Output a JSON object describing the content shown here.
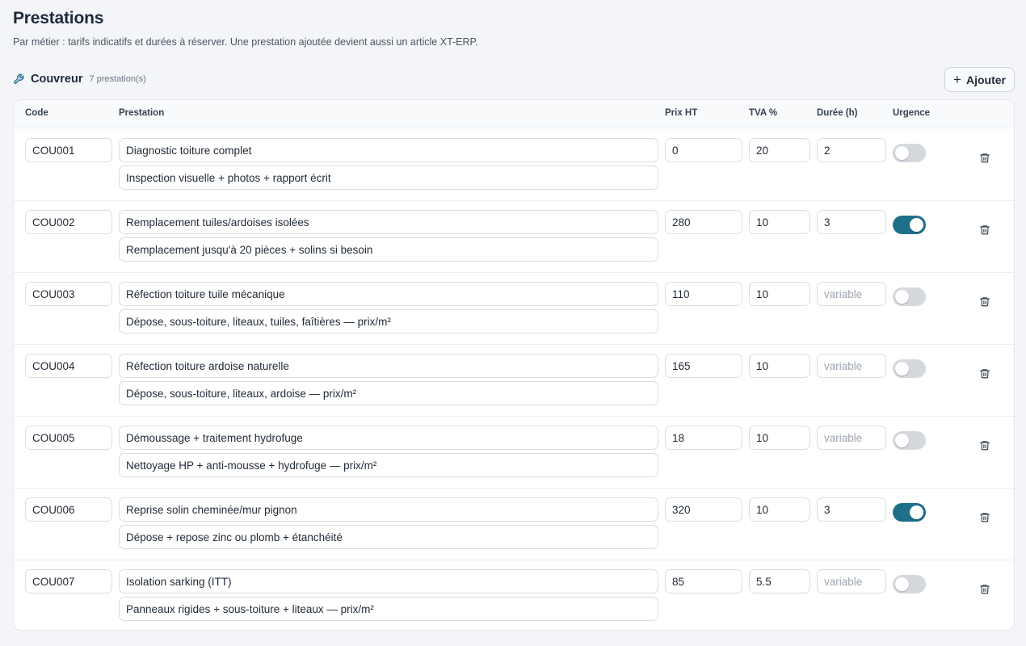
{
  "page": {
    "title": "Prestations",
    "subtitle": "Par métier : tarifs indicatifs et durées à réserver. Une prestation ajoutée devient aussi un article XT-ERP."
  },
  "section": {
    "icon": "wrench-icon",
    "title": "Couvreur",
    "count": "7 prestation(s)",
    "add_label": "Ajouter",
    "add_icon": "plus-icon"
  },
  "table": {
    "headers": {
      "code": "Code",
      "prestation": "Prestation",
      "prix": "Prix HT",
      "tva": "TVA %",
      "duree": "Durée (h)",
      "urgence": "Urgence"
    },
    "duration_placeholder": "variable",
    "accent_color": "#1f6f8b",
    "rows": [
      {
        "code": "COU001",
        "name": "Diagnostic toiture complet",
        "description": "Inspection visuelle + photos + rapport écrit",
        "prix": "0",
        "tva": "20",
        "duree": "2",
        "urgence": false
      },
      {
        "code": "COU002",
        "name": "Remplacement tuiles/ardoises isolées",
        "description": "Remplacement jusqu'à 20 pièces + solins si besoin",
        "prix": "280",
        "tva": "10",
        "duree": "3",
        "urgence": true
      },
      {
        "code": "COU003",
        "name": "Réfection toiture tuile mécanique",
        "description": "Dépose, sous-toiture, liteaux, tuiles, faîtières — prix/m²",
        "prix": "110",
        "tva": "10",
        "duree": "",
        "urgence": false
      },
      {
        "code": "COU004",
        "name": "Réfection toiture ardoise naturelle",
        "description": "Dépose, sous-toiture, liteaux, ardoise — prix/m²",
        "prix": "165",
        "tva": "10",
        "duree": "",
        "urgence": false
      },
      {
        "code": "COU005",
        "name": "Démoussage + traitement hydrofuge",
        "description": "Nettoyage HP + anti-mousse + hydrofuge — prix/m²",
        "prix": "18",
        "tva": "10",
        "duree": "",
        "urgence": false
      },
      {
        "code": "COU006",
        "name": "Reprise solin cheminée/mur pignon",
        "description": "Dépose + repose zinc ou plomb + étanchéité",
        "prix": "320",
        "tva": "10",
        "duree": "3",
        "urgence": true
      },
      {
        "code": "COU007",
        "name": "Isolation sarking (ITT)",
        "description": "Panneaux rigides + sous-toiture + liteaux — prix/m²",
        "prix": "85",
        "tva": "5.5",
        "duree": "",
        "urgence": false
      }
    ]
  }
}
